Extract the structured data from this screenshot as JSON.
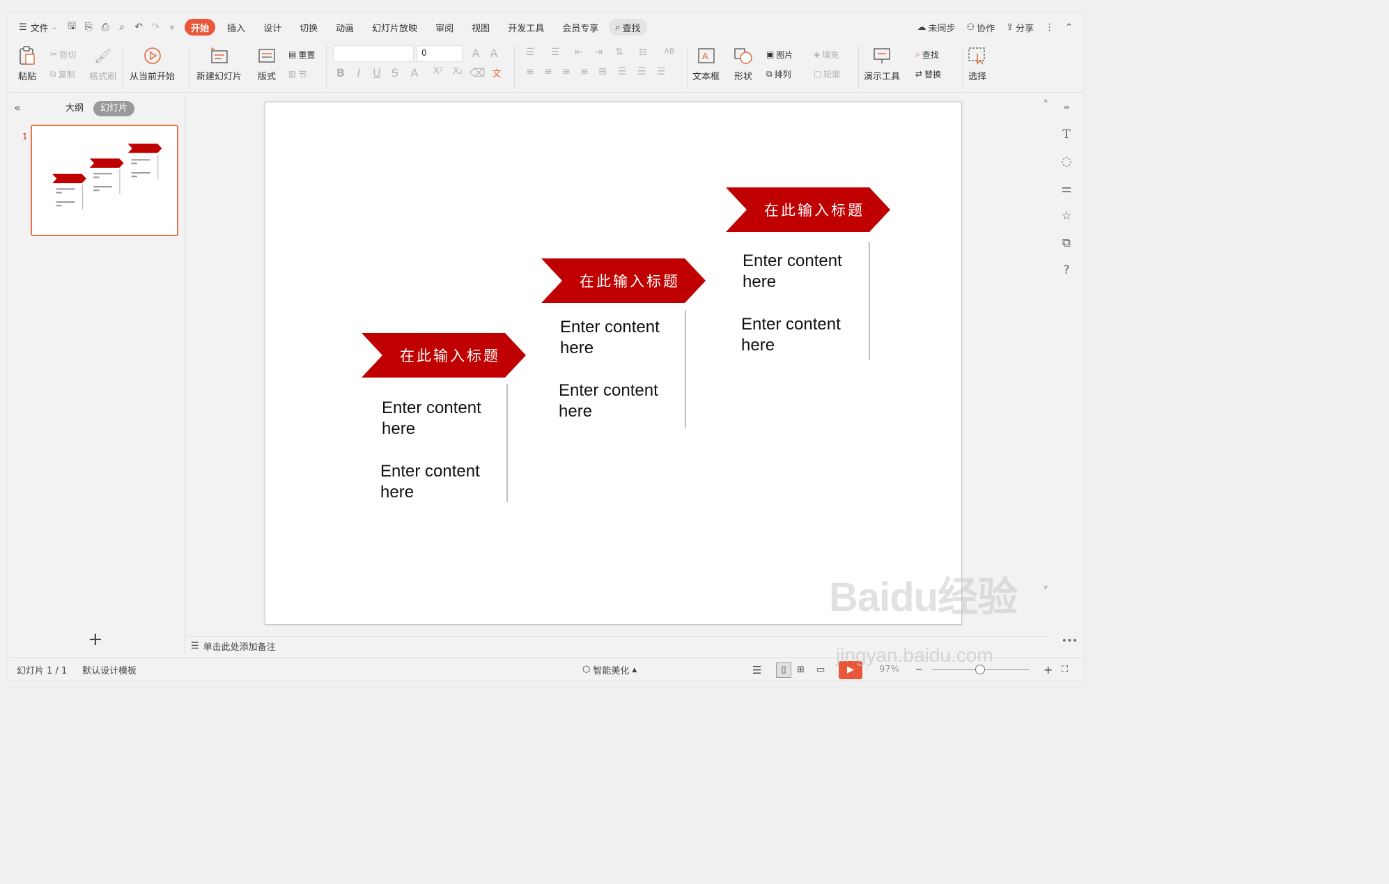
{
  "menubar": {
    "file": "文件",
    "tabs": [
      "开始",
      "插入",
      "设计",
      "切换",
      "动画",
      "幻灯片放映",
      "审阅",
      "视图",
      "开发工具",
      "会员专享"
    ],
    "active_tab": "开始",
    "search": "查找",
    "sync": "未同步",
    "collab": "协作",
    "share": "分享"
  },
  "ribbon": {
    "paste": "粘贴",
    "cut": "剪切",
    "copy": "复制",
    "format_painter": "格式刷",
    "play_from_current": "从当前开始",
    "new_slide": "新建幻灯片",
    "layout": "版式",
    "reset": "重置",
    "section": "节",
    "font_size": "0",
    "text_box": "文本框",
    "shape": "形状",
    "picture": "图片",
    "fill": "填充",
    "arrange": "排列",
    "outline": "轮廓",
    "present_tools": "演示工具",
    "find": "查找",
    "replace": "替换",
    "select": "选择"
  },
  "left_pane": {
    "outline_tab": "大纲",
    "slides_tab": "幻灯片",
    "slide_number": "1"
  },
  "slide": {
    "columns": [
      {
        "title": "在此输入标题",
        "items": [
          "Enter content here",
          "Enter content here"
        ]
      },
      {
        "title": "在此输入标题",
        "items": [
          "Enter content here",
          "Enter content here"
        ]
      },
      {
        "title": "在此输入标题",
        "items": [
          "Enter content here",
          "Enter content here"
        ]
      }
    ],
    "accent_color": "#c00000"
  },
  "notes": {
    "placeholder": "单击此处添加备注"
  },
  "statusbar": {
    "slide_info": "幻灯片 1 / 1",
    "template": "默认设计模板",
    "beautify": "智能美化",
    "zoom": "97%"
  },
  "watermark": {
    "brand": "Baidu经验",
    "url": "jingyan.baidu.com"
  }
}
